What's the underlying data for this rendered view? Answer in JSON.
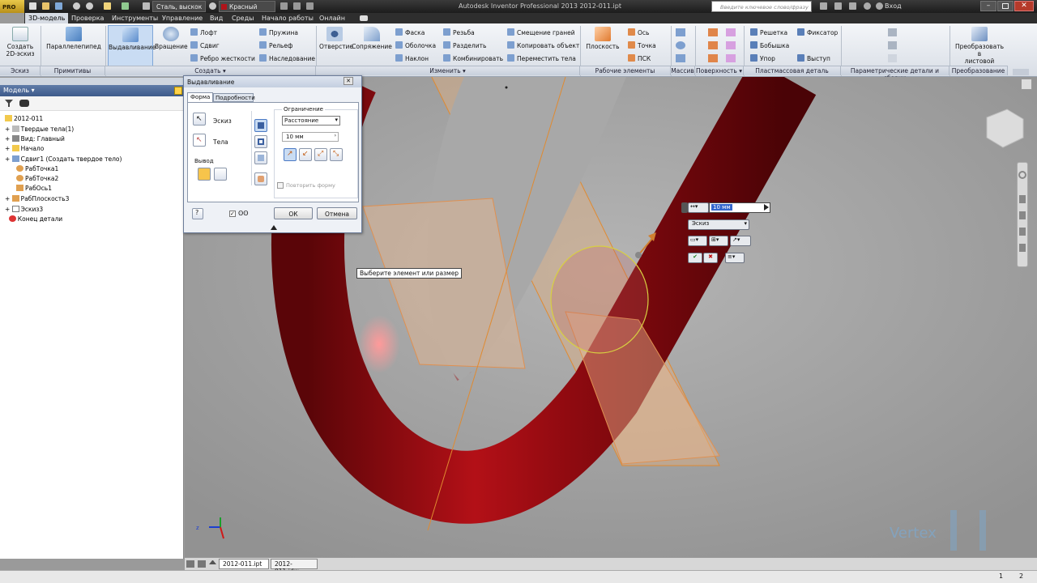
{
  "titlebar": {
    "app_badge": "PRO",
    "material": "Сталь, выскок",
    "appearance": "Красный",
    "window_title": "Autodesk Inventor Professional 2013    2012-011.ipt",
    "search_placeholder": "Введите ключевое слово/фразу",
    "login": "Вход"
  },
  "menu": {
    "tabs": [
      "3D-модель",
      "Проверка",
      "Инструменты",
      "Управление",
      "Вид",
      "Среды",
      "Начало работы",
      "Онлайн"
    ],
    "active": "3D-модель"
  },
  "ribbon": {
    "sketch": {
      "create_2d_sketch": "Создать\n2D-эскиз",
      "panel": "Эскиз"
    },
    "primitives": {
      "box": "Параллелепипед",
      "panel": "Примитивы"
    },
    "create": {
      "extrude": "Выдавливание",
      "revolve": "Вращение",
      "loft": "Лофт",
      "sweep": "Сдвиг",
      "rib": "Ребро жесткости",
      "coil": "Пружина",
      "emboss": "Рельеф",
      "derive": "Наследование",
      "panel": "Создать"
    },
    "modify": {
      "hole": "Отверстие",
      "fillet": "Сопряжение",
      "chamfer": "Фаска",
      "shell": "Оболочка",
      "draft": "Наклон",
      "thread": "Резьба",
      "split": "Разделить",
      "combine": "Комбинировать",
      "offset_faces": "Смещение граней",
      "copy_object": "Копировать объект",
      "move_bodies": "Переместить тела",
      "panel": "Изменить"
    },
    "work_features": {
      "plane": "Плоскость",
      "axis": "Ось",
      "point": "Точка",
      "ucs": "ПСК",
      "panel": "Рабочие элементы"
    },
    "pattern": {
      "panel": "Массив"
    },
    "surface": {
      "panel": "Поверхность"
    },
    "plastic": {
      "grill": "Решетка",
      "boss": "Бобышка",
      "rest": "Упор",
      "snap": "Фиксатор",
      "lip": "Выступ",
      "panel": "Пластмассовая деталь"
    },
    "harness": {
      "panel": "Параметрические детали и сборки"
    },
    "convert": {
      "to_sheet_metal": "Преобразовать в\nлистовой металл",
      "panel": "Преобразование"
    }
  },
  "browser": {
    "title": "Модель",
    "items": [
      {
        "label": "2012-011",
        "level": 0
      },
      {
        "label": "Твердые тела(1)",
        "level": 1
      },
      {
        "label": "Вид: Главный",
        "level": 1
      },
      {
        "label": "Начало",
        "level": 1
      },
      {
        "label": "Сдвиг1 (Создать твердое тело)",
        "level": 1
      },
      {
        "label": "РабТочка1",
        "level": 1
      },
      {
        "label": "РабТочка2",
        "level": 1
      },
      {
        "label": "РабОсь1",
        "level": 1
      },
      {
        "label": "РабПлоскость3",
        "level": 1
      },
      {
        "label": "Эскиз3",
        "level": 1
      },
      {
        "label": "Конец детали",
        "level": 1
      }
    ]
  },
  "dialog": {
    "title": "Выдавливание",
    "tabs": [
      "Форма",
      "Подробности"
    ],
    "sketch_label": "Эскиз",
    "bodies_label": "Тела",
    "output_label": "Вывод",
    "extents_label": "Ограничение",
    "extents_value": "Расстояние",
    "distance_value": "10 мм",
    "repeat_label": "Повторить форму",
    "ok": "ОК",
    "cancel": "Отмена"
  },
  "viewport": {
    "tooltip": "Выберите элемент или размер",
    "mini_distance": "10 мм",
    "mini_profile": "Эскиз",
    "watermark": "Vertex"
  },
  "doc_tabs": [
    "2012-011.ipt",
    "2012-011.idw"
  ],
  "status": {
    "left": "1",
    "right": "2"
  },
  "colors": {
    "part": "#9e0f14",
    "workplane": "#e0b080",
    "ribbon_active": "#c9dcf3",
    "menu_bg": "#2e2e2e"
  }
}
